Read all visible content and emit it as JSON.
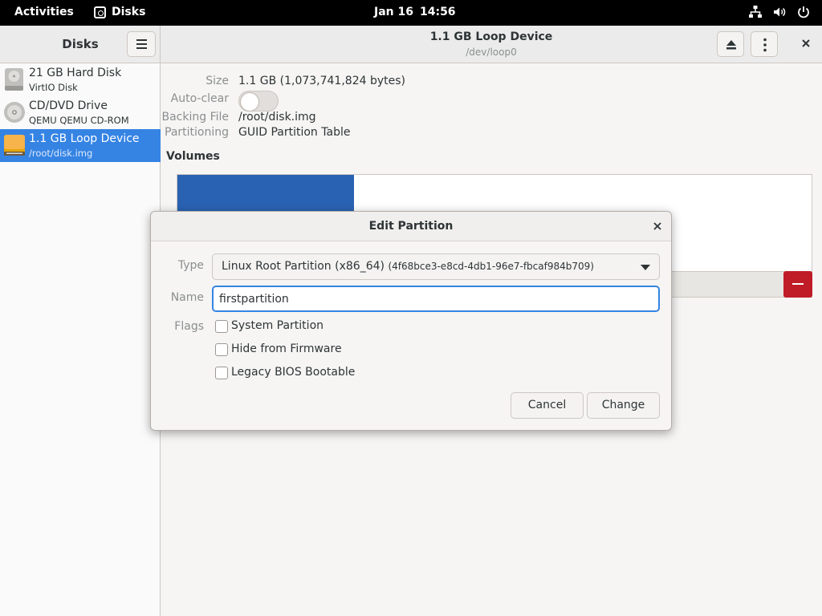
{
  "topbar": {
    "activities": "Activities",
    "app_name": "Disks",
    "date": "Jan 16",
    "time": "14:56",
    "tray_icons": [
      "network-icon",
      "volume-icon",
      "power-icon"
    ]
  },
  "sidebar": {
    "title": "Disks",
    "disks": [
      {
        "name": "21 GB Hard Disk",
        "sub": "VirtIO Disk",
        "icon": "hard-disk-icon",
        "selected": false
      },
      {
        "name": "CD/DVD Drive",
        "sub": "QEMU QEMU CD-ROM",
        "icon": "optical-drive-icon",
        "selected": false
      },
      {
        "name": "1.1 GB Loop Device",
        "sub": "/root/disk.img",
        "icon": "loop-device-icon",
        "selected": true
      }
    ]
  },
  "main": {
    "title": "1.1 GB Loop Device",
    "subtitle": "/dev/loop0",
    "properties": [
      {
        "label": "Size",
        "value": "1.1 GB (1,073,741,824 bytes)"
      },
      {
        "label": "Auto-clear",
        "value": ""
      },
      {
        "label": "Backing File",
        "value": "/root/disk.img"
      },
      {
        "label": "Partitioning",
        "value": "GUID Partition Table"
      }
    ],
    "volumes_title": "Volumes"
  },
  "dialog": {
    "title": "Edit Partition",
    "type_label": "Type",
    "type_value": "Linux Root Partition (x86_64)",
    "type_guid": "(4f68bce3-e8cd-4db1-96e7-fbcaf984b709)",
    "name_label": "Name",
    "name_value": "firstpartition",
    "flags_label": "Flags",
    "flags": [
      {
        "label": "System Partition",
        "checked": false
      },
      {
        "label": "Hide from Firmware",
        "checked": false
      },
      {
        "label": "Legacy BIOS Bootable",
        "checked": false
      }
    ],
    "cancel_label": "Cancel",
    "change_label": "Change"
  },
  "colors": {
    "accent": "#3584e4",
    "volume_fill": "#2a62b3",
    "destructive": "#c01c28"
  }
}
